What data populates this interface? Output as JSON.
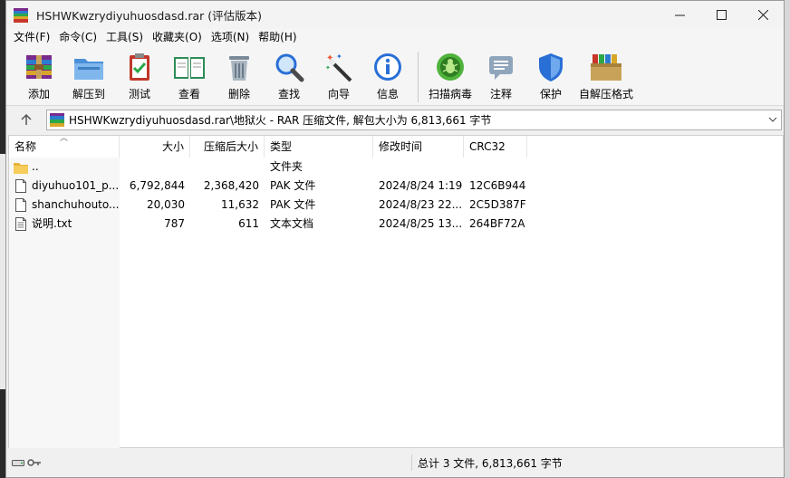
{
  "window": {
    "title": "HSHWKwzrydiyuhuosdasd.rar (评估版本)",
    "controls": {
      "minimize": "—",
      "maximize": "☐",
      "close": "✕"
    }
  },
  "menu": [
    "文件(F)",
    "命令(C)",
    "工具(S)",
    "收藏夹(O)",
    "选项(N)",
    "帮助(H)"
  ],
  "toolbar": [
    {
      "label": "添加",
      "icon": "add-archive-icon"
    },
    {
      "label": "解压到",
      "icon": "extract-folder-icon"
    },
    {
      "label": "测试",
      "icon": "test-clipboard-icon"
    },
    {
      "label": "查看",
      "icon": "view-book-icon"
    },
    {
      "label": "删除",
      "icon": "trash-icon"
    },
    {
      "label": "查找",
      "icon": "magnifier-icon"
    },
    {
      "label": "向导",
      "icon": "wizard-wand-icon"
    },
    {
      "label": "信息",
      "icon": "info-icon"
    },
    {
      "label": "扫描病毒",
      "icon": "virus-scan-icon"
    },
    {
      "label": "注释",
      "icon": "comment-icon"
    },
    {
      "label": "保护",
      "icon": "shield-icon"
    },
    {
      "label": "自解压格式",
      "icon": "sfx-box-icon"
    }
  ],
  "address": {
    "path": "HSHWKwzrydiyuhuosdasd.rar\\地狱火 - RAR 压缩文件, 解包大小为 6,813,661 字节"
  },
  "columns": {
    "name": "名称",
    "size": "大小",
    "packed": "压缩后大小",
    "type": "类型",
    "mtime": "修改时间",
    "crc": "CRC32"
  },
  "files": [
    {
      "name": "..",
      "size": "",
      "packed": "",
      "type": "文件夹",
      "mtime": "",
      "crc": "",
      "icon": "folder-icon"
    },
    {
      "name": "diyuhuo101_p....",
      "size": "6,792,844",
      "packed": "2,368,420",
      "type": "PAK 文件",
      "mtime": "2024/8/24 1:19",
      "crc": "12C6B944",
      "icon": "file-icon"
    },
    {
      "name": "shanchuhouto...",
      "size": "20,030",
      "packed": "11,632",
      "type": "PAK 文件",
      "mtime": "2024/8/23 22...",
      "crc": "2C5D387F",
      "icon": "file-icon"
    },
    {
      "name": "说明.txt",
      "size": "787",
      "packed": "611",
      "type": "文本文档",
      "mtime": "2024/8/25 13...",
      "crc": "264BF72A",
      "icon": "text-file-icon"
    }
  ],
  "status": {
    "summary": "总计 3 文件, 6,813,661 字节"
  },
  "colors": {
    "accent_blue": "#2a6fd6",
    "folder_yellow": "#f2c14e"
  }
}
